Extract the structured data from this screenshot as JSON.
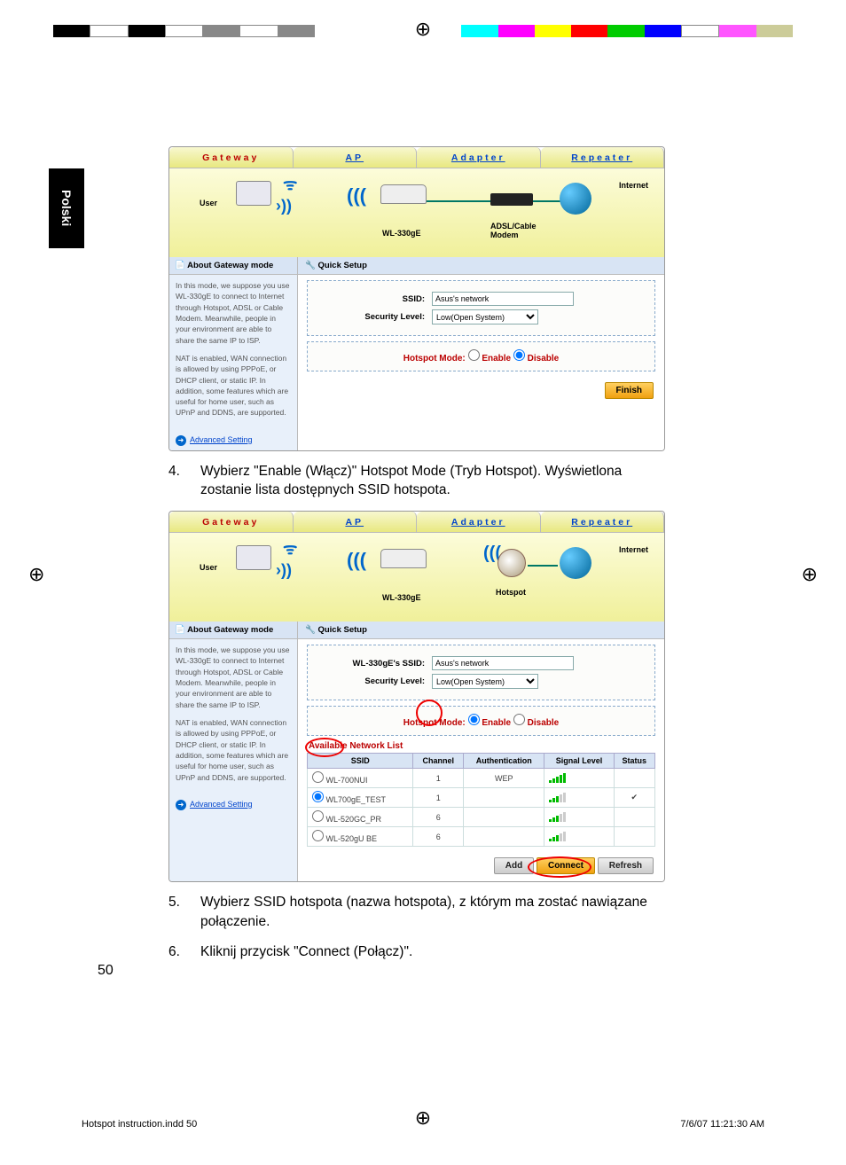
{
  "lang_tab": "Polski",
  "reg_mark": "⊕",
  "tabs": {
    "gateway": "Gateway",
    "ap": "AP",
    "adapter": "Adapter",
    "repeater": "Repeater"
  },
  "diagram": {
    "user": "User",
    "router": "WL-330gE",
    "modem": "ADSL/Cable\nModem",
    "internet": "Internet",
    "hotspot": "Hotspot"
  },
  "side": {
    "head": "About Gateway mode",
    "p1": "In this mode, we suppose you use WL-330gE to connect to Internet through Hotspot, ADSL or Cable Modem. Meanwhile, people in your environment are able to share the same IP to ISP.",
    "p2": "NAT is enabled, WAN connection is allowed by using PPPoE, or DHCP client, or static IP. In addition, some features which are useful for home user, such as UPnP and DDNS, are supported.",
    "adv": "Advanced Setting"
  },
  "qs": {
    "head": "Quick Setup",
    "ssid_lbl": "SSID:",
    "ssid_val": "Asus's network",
    "ssid2_lbl": "WL-330gE's SSID:",
    "ssid2_val": "Asus's network",
    "sec_lbl": "Security Level:",
    "sec_val": "Low(Open System)",
    "hotspot_lbl": "Hotspot Mode:",
    "enable": "Enable",
    "disable": "Disable",
    "finish": "Finish"
  },
  "netlist": {
    "title": "Available Network List",
    "h_ssid": "SSID",
    "h_ch": "Channel",
    "h_auth": "Authentication",
    "h_sig": "Signal Level",
    "h_st": "Status",
    "rows": [
      {
        "ssid": "WL-700NUI",
        "ch": "1",
        "auth": "WEP",
        "sig": 5
      },
      {
        "ssid": "WL700gE_TEST",
        "ch": "1",
        "auth": "",
        "sig": 3,
        "sel": true
      },
      {
        "ssid": "WL-520GC_PR",
        "ch": "6",
        "auth": "",
        "sig": 3
      },
      {
        "ssid": "WL-520gU BE",
        "ch": "6",
        "auth": "",
        "sig": 3
      }
    ],
    "add": "Add",
    "connect": "Connect",
    "refresh": "Refresh"
  },
  "step4": "Wybierz \"Enable (Włącz)\" Hotspot Mode (Tryb Hotspot). Wyświetlona zostanie lista dostępnych SSID hotspota.",
  "step5": "Wybierz SSID hotspota (nazwa hotspota), z którym ma zostać nawiązane połączenie.",
  "step6": "Kliknij przycisk \"Connect (Połącz)\".",
  "n4": "4.",
  "n5": "5.",
  "n6": "6.",
  "page_num": "50",
  "footer": {
    "file": "Hotspot instruction.indd   50",
    "ts": "7/6/07   11:21:30 AM"
  }
}
